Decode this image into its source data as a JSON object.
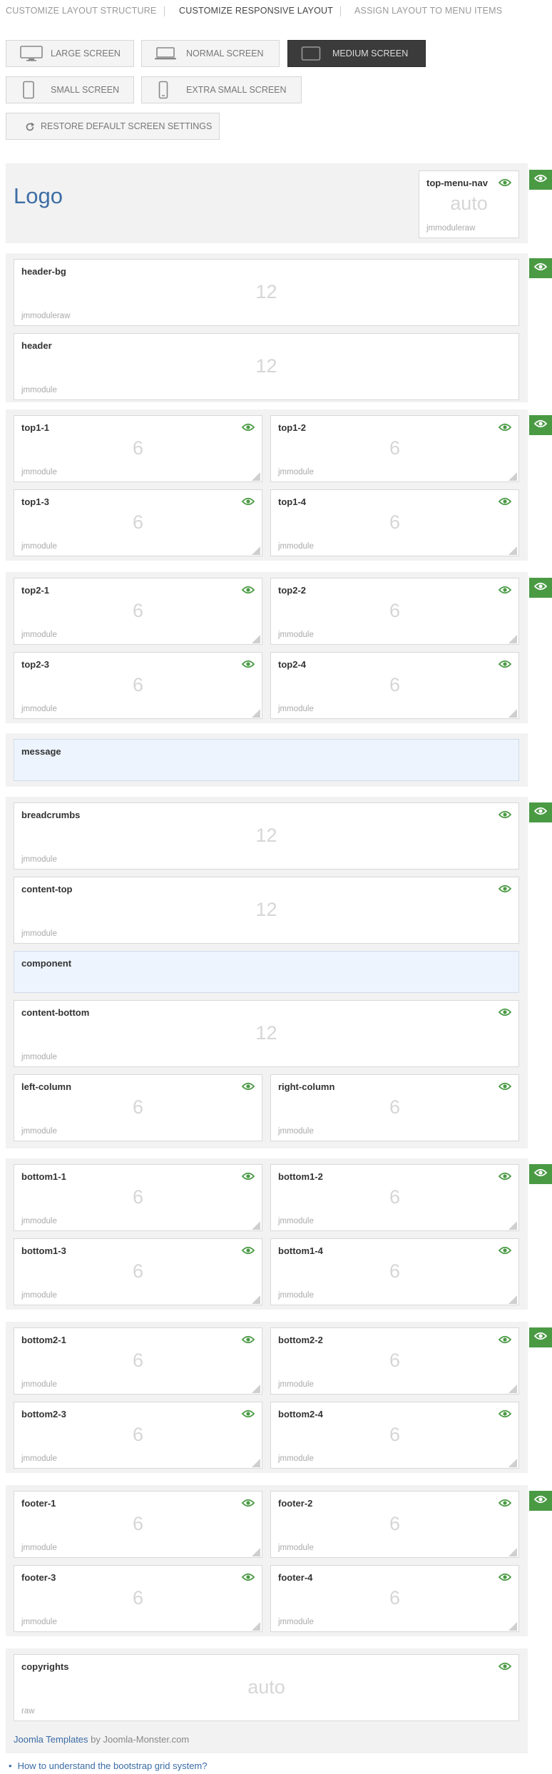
{
  "tabs": {
    "structure": "CUSTOMIZE LAYOUT STRUCTURE",
    "responsive": "CUSTOMIZE RESPONSIVE LAYOUT",
    "assign": "ASSIGN LAYOUT TO MENU ITEMS",
    "active": "responsive"
  },
  "screens": {
    "large": "LARGE SCREEN",
    "normal": "NORMAL SCREEN",
    "medium": "MEDIUM SCREEN",
    "small": "SMALL SCREEN",
    "xsmall": "EXTRA SMALL SCREEN",
    "selected": "medium",
    "restore": "RESTORE DEFAULT SCREEN SETTINGS"
  },
  "colors": {
    "accent_green": "#4a9a44",
    "link_blue": "#3a6ba5",
    "active_button": "#3b3b3b"
  },
  "logo": {
    "text": "Logo"
  },
  "modules": {
    "top_menu_nav": {
      "name": "top-menu-nav",
      "size": "auto",
      "type": "jmmoduleraw",
      "visible": true
    },
    "header_bg": {
      "name": "header-bg",
      "size": "12",
      "type": "jmmoduleraw"
    },
    "header": {
      "name": "header",
      "size": "12",
      "type": "jmmodule"
    },
    "top1_1": {
      "name": "top1-1",
      "size": "6",
      "type": "jmmodule",
      "visible": true
    },
    "top1_2": {
      "name": "top1-2",
      "size": "6",
      "type": "jmmodule",
      "visible": true
    },
    "top1_3": {
      "name": "top1-3",
      "size": "6",
      "type": "jmmodule",
      "visible": true
    },
    "top1_4": {
      "name": "top1-4",
      "size": "6",
      "type": "jmmodule",
      "visible": true
    },
    "top2_1": {
      "name": "top2-1",
      "size": "6",
      "type": "jmmodule",
      "visible": true
    },
    "top2_2": {
      "name": "top2-2",
      "size": "6",
      "type": "jmmodule",
      "visible": true
    },
    "top2_3": {
      "name": "top2-3",
      "size": "6",
      "type": "jmmodule",
      "visible": true
    },
    "top2_4": {
      "name": "top2-4",
      "size": "6",
      "type": "jmmodule",
      "visible": true
    },
    "message": {
      "name": "message"
    },
    "breadcrumbs": {
      "name": "breadcrumbs",
      "size": "12",
      "type": "jmmodule",
      "visible": true
    },
    "content_top": {
      "name": "content-top",
      "size": "12",
      "type": "jmmodule",
      "visible": true
    },
    "component": {
      "name": "component"
    },
    "content_bottom": {
      "name": "content-bottom",
      "size": "12",
      "type": "jmmodule",
      "visible": true
    },
    "left_column": {
      "name": "left-column",
      "size": "6",
      "type": "jmmodule",
      "visible": true
    },
    "right_column": {
      "name": "right-column",
      "size": "6",
      "type": "jmmodule",
      "visible": true
    },
    "bottom1_1": {
      "name": "bottom1-1",
      "size": "6",
      "type": "jmmodule",
      "visible": true
    },
    "bottom1_2": {
      "name": "bottom1-2",
      "size": "6",
      "type": "jmmodule",
      "visible": true
    },
    "bottom1_3": {
      "name": "bottom1-3",
      "size": "6",
      "type": "jmmodule",
      "visible": true
    },
    "bottom1_4": {
      "name": "bottom1-4",
      "size": "6",
      "type": "jmmodule",
      "visible": true
    },
    "bottom2_1": {
      "name": "bottom2-1",
      "size": "6",
      "type": "jmmodule",
      "visible": true
    },
    "bottom2_2": {
      "name": "bottom2-2",
      "size": "6",
      "type": "jmmodule",
      "visible": true
    },
    "bottom2_3": {
      "name": "bottom2-3",
      "size": "6",
      "type": "jmmodule",
      "visible": true
    },
    "bottom2_4": {
      "name": "bottom2-4",
      "size": "6",
      "type": "jmmodule",
      "visible": true
    },
    "footer_1": {
      "name": "footer-1",
      "size": "6",
      "type": "jmmodule",
      "visible": true
    },
    "footer_2": {
      "name": "footer-2",
      "size": "6",
      "type": "jmmodule",
      "visible": true
    },
    "footer_3": {
      "name": "footer-3",
      "size": "6",
      "type": "jmmodule",
      "visible": true
    },
    "footer_4": {
      "name": "footer-4",
      "size": "6",
      "type": "jmmodule",
      "visible": true
    },
    "copyrights": {
      "name": "copyrights",
      "size": "auto",
      "type": "raw",
      "visible": true
    }
  },
  "footer": {
    "link": "Joomla Templates",
    "by": " by Joomla-Monster.com"
  },
  "help": {
    "link": "How to understand the bootstrap grid system?"
  }
}
